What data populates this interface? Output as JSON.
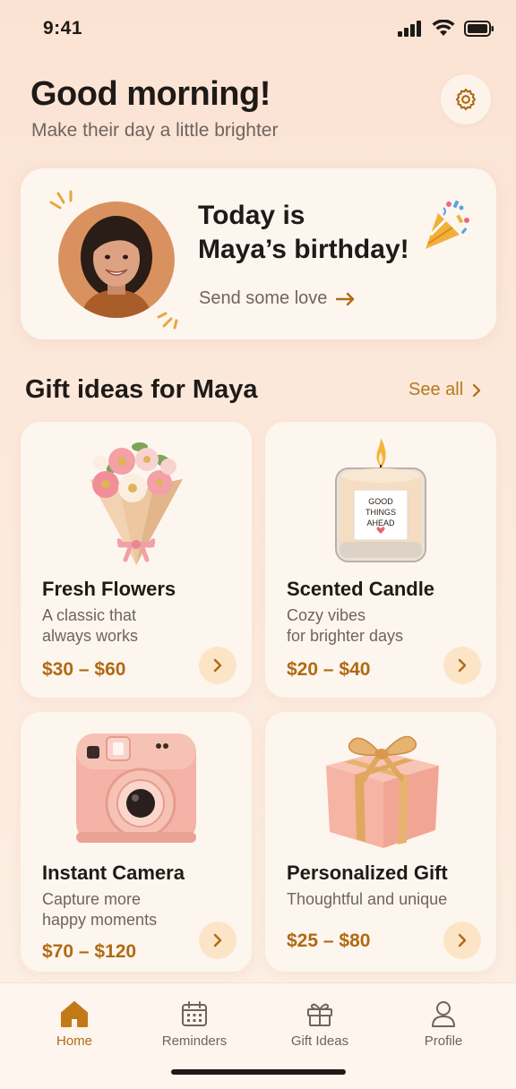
{
  "status_bar": {
    "time": "9:41"
  },
  "header": {
    "greeting": "Good morning!",
    "subtitle": "Make their day a little brighter"
  },
  "birthday": {
    "line1": "Today is",
    "line2": "Maya’s birthday!",
    "cta": "Send some love"
  },
  "gift_section": {
    "title": "Gift ideas for Maya",
    "see_all": "See all"
  },
  "gifts": [
    {
      "name": "Fresh Flowers",
      "desc_line1": "A classic that",
      "desc_line2": "always works",
      "price": "$30 – $60",
      "icon": "flower-bouquet"
    },
    {
      "name": "Scented Candle",
      "desc_line1": "Cozy vibes",
      "desc_line2": "for brighter days",
      "price": "$20 – $40",
      "icon": "candle",
      "candle_label": [
        "GOOD",
        "THINGS",
        "AHEAD"
      ]
    },
    {
      "name": "Instant Camera",
      "desc_line1": "Capture more",
      "desc_line2": "happy moments",
      "price": "$70 – $120",
      "icon": "camera"
    },
    {
      "name": "Personalized Gift",
      "desc_line1": "Thoughtful and unique",
      "desc_line2": "",
      "price": "$25 – $80",
      "icon": "gift-box"
    }
  ],
  "nav": {
    "items": [
      {
        "label": "Home",
        "icon": "home-icon",
        "active": true
      },
      {
        "label": "Reminders",
        "icon": "calendar-icon",
        "active": false
      },
      {
        "label": "Gift Ideas",
        "icon": "gift-icon",
        "active": false
      },
      {
        "label": "Profile",
        "icon": "person-icon",
        "active": false
      }
    ]
  },
  "colors": {
    "accent": "#b06a12",
    "card_bg": "#fdf6ef",
    "page_bg": "#fbe3d3",
    "arrow_bg": "#fbe5c6"
  }
}
